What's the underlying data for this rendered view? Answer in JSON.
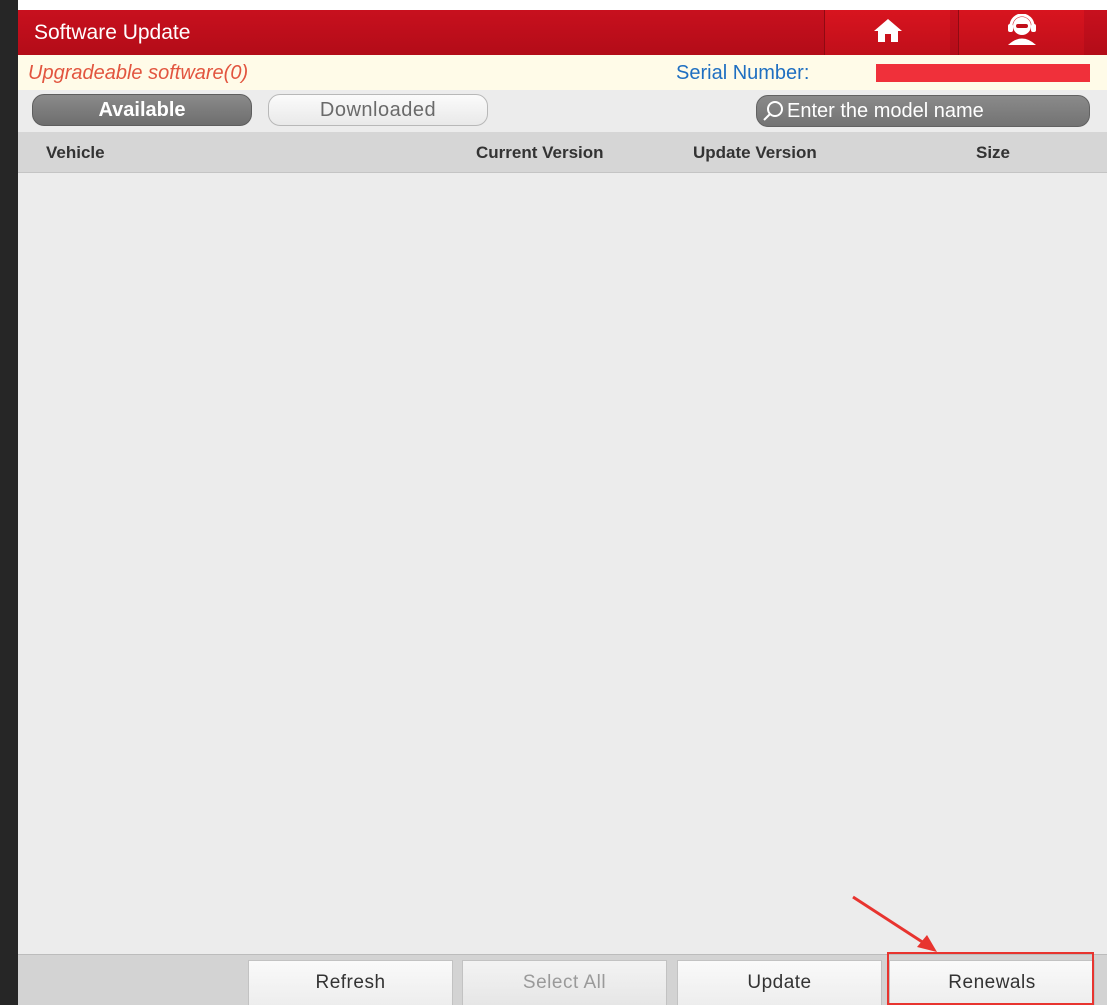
{
  "header": {
    "title": "Software Update",
    "home_icon": "home-icon",
    "support_icon": "support-agent-icon",
    "accent_color": "#c8101e"
  },
  "info": {
    "upgradeable_text": "Upgradeable software(0)",
    "serial_label": "Serial Number:",
    "upgradeable_color": "#e2553f",
    "serial_color": "#1f6fc1"
  },
  "tabs": [
    {
      "label": "Available",
      "active": true
    },
    {
      "label": "Downloaded",
      "active": false
    }
  ],
  "search": {
    "placeholder": "Enter the model name",
    "icon": "search-icon"
  },
  "table": {
    "columns": [
      "Vehicle",
      "Current Version",
      "Update Version",
      "Size"
    ],
    "rows": []
  },
  "bottom_bar": {
    "refresh": "Refresh",
    "select_all": "Select All",
    "update": "Update",
    "renewals": "Renewals"
  },
  "annotation": {
    "highlight_color": "#e8342f",
    "highlighted_button": "Renewals"
  }
}
